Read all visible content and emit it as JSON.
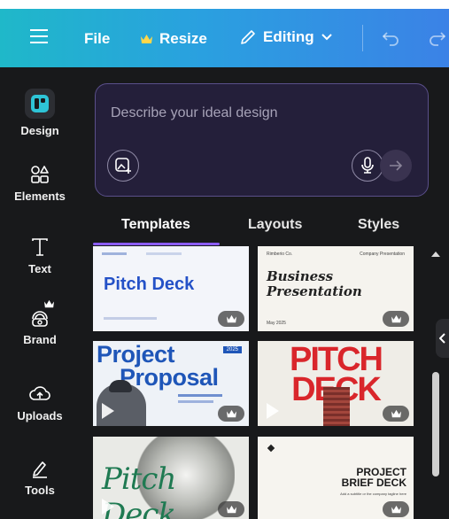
{
  "topbar": {
    "file_label": "File",
    "resize_label": "Resize",
    "editing_label": "Editing"
  },
  "sidebar": {
    "items": [
      {
        "label": "Design",
        "icon": "design-icon"
      },
      {
        "label": "Elements",
        "icon": "elements-icon"
      },
      {
        "label": "Text",
        "icon": "text-icon"
      },
      {
        "label": "Brand",
        "icon": "brand-icon"
      },
      {
        "label": "Uploads",
        "icon": "uploads-icon"
      },
      {
        "label": "Tools",
        "icon": "tools-icon"
      }
    ]
  },
  "prompt": {
    "placeholder": "Describe your ideal design"
  },
  "tabs": [
    {
      "label": "Templates"
    },
    {
      "label": "Layouts"
    },
    {
      "label": "Styles"
    }
  ],
  "templates": [
    {
      "title": "Pitch Deck"
    },
    {
      "title_line1": "Business",
      "title_line2": "Presentation",
      "header_left": "Rimberio Co.",
      "header_right": "Company Presentation",
      "footer": "May 2025"
    },
    {
      "title_line1": "Project",
      "title_line2": "Proposal",
      "badge": "2025"
    },
    {
      "title_line1": "PITCH",
      "title_line2": "DECK"
    },
    {
      "title": "Pitch Deck"
    },
    {
      "title_line1": "PROJECT",
      "title_line2": "BRIEF DECK",
      "subtitle": "Add a subtitle or the company tagline here"
    }
  ],
  "colors": {
    "accent": "#8b5cf6",
    "topbar_start": "#1fb8c9",
    "topbar_end": "#3b82e6",
    "panel_bg": "#18191b"
  }
}
